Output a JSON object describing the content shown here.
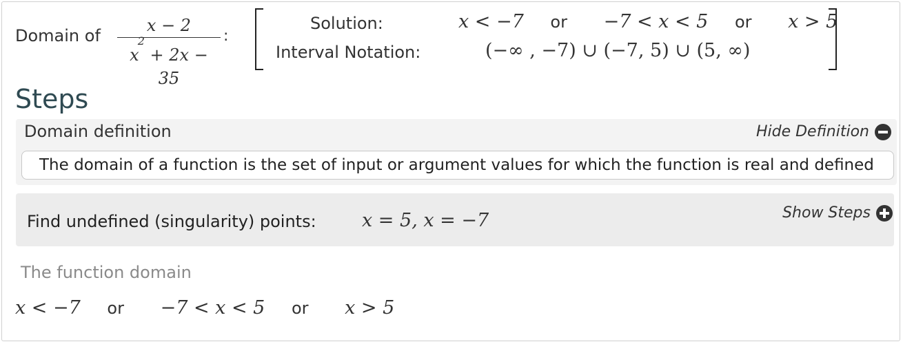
{
  "header": {
    "domain_label": "Domain of",
    "fraction": {
      "numerator": "x − 2",
      "denominator_base": "x",
      "denominator_exp": "2",
      "denominator_rest": " + 2x − 35"
    },
    "colon": ":",
    "solution_label": "Solution:",
    "interval_label": "Interval Notation:",
    "solution": {
      "part1": "x < −7",
      "or1": "or",
      "part2": "−7 < x < 5",
      "or2": "or",
      "part3": "x > 5"
    },
    "interval": "(−∞ , −7) ∪ (−7, 5) ∪ (5, ∞)"
  },
  "steps_title": "Steps",
  "definition": {
    "title": "Domain definition",
    "hide_label": "Hide Definition",
    "hide_icon": "minus-circle-icon",
    "text": "The domain of a function is the set of input or argument values for which the function is real and defined"
  },
  "singularity": {
    "label": "Find undefined (singularity) points:",
    "expr": "x = 5, x = −7",
    "show_label": "Show Steps",
    "show_icon": "plus-circle-icon"
  },
  "function_domain": {
    "title": "The function domain",
    "part1": "x < −7",
    "or1": "or",
    "part2": "−7 < x < 5",
    "or2": "or",
    "part3": "x > 5"
  }
}
